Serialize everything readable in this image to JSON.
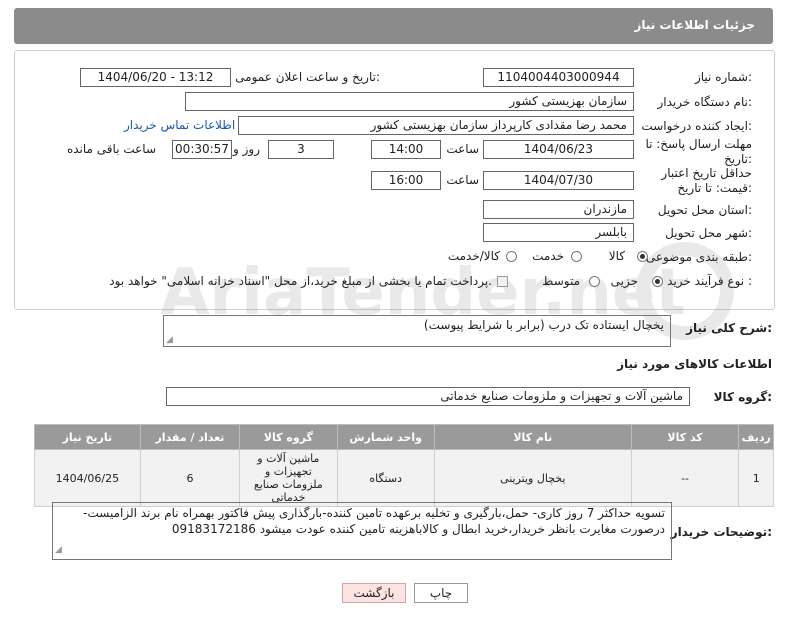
{
  "header": {
    "title": "جزئیات اطلاعات نیاز"
  },
  "fields": {
    "need_number_label": "شماره نیاز:",
    "need_number": "1104004403000944",
    "announce_label": "تاریخ و ساعت اعلان عمومی:",
    "announce_value": "1404/06/20 - 13:12",
    "buyer_org_label": "نام دستگاه خریدار:",
    "buyer_org": "سازمان بهزیستی کشور",
    "creator_label": "ایجاد کننده درخواست:",
    "creator": "محمد رضا  مقدادی کارپرداز سازمان بهزیستی کشور",
    "contact_link": "اطلاعات تماس خریدار",
    "reply_deadline_label": "مهلت ارسال پاسخ: تا تاریخ:",
    "reply_date": "1404/06/23",
    "time_label": "ساعت",
    "reply_time": "14:00",
    "days_value": "3",
    "days_label": "روز و",
    "remaining_time": "00:30:57",
    "remaining_label": "ساعت باقی مانده",
    "price_deadline_label": "حداقل تاریخ اعتبار قیمت: تا تاریخ:",
    "price_date": "1404/07/30",
    "price_time": "16:00",
    "province_label": "استان محل تحویل:",
    "province": "مازندران",
    "city_label": "شهر محل تحویل:",
    "city": "بابلسر",
    "category_label": "طبقه بندی موضوعی:",
    "category_options": [
      "کالا",
      "خدمت",
      "کالا/خدمت"
    ],
    "process_label": "نوع فرآیند خرید :",
    "process_options": [
      "جزیی",
      "متوسط"
    ],
    "payment_note": "پرداخت تمام یا بخشی از مبلغ خرید،از محل \"اسناد خزانه اسلامی\" خواهد بود."
  },
  "summary": {
    "label": "شرح کلی نیاز:",
    "value": "یخچال ایستاده تک درب (برابر با شرایط پیوست)"
  },
  "goods_info_title": "اطلاعات کالاهای مورد نیاز",
  "goods_group": {
    "label": "گروه کالا:",
    "value": "ماشین آلات و تجهیزات و ملزومات صنایع خدماتی"
  },
  "table": {
    "headers": [
      "ردیف",
      "کد کالا",
      "نام کالا",
      "واحد شمارش",
      "گروه کالا",
      "تعداد / مقدار",
      "تاریخ نیاز"
    ],
    "rows": [
      [
        "1",
        "--",
        "یخچال ویترینی",
        "دستگاه",
        "ماشین آلات و تجهیزات و ملزومات صنایع خدماتی",
        "6",
        "1404/06/25"
      ]
    ]
  },
  "buyer_notes": {
    "label": "توضیحات خریدار:",
    "value": "تسویه حداکثر 7 روز کاری- حمل،بارگیری و تخلیه برعهده تامین کننده-بارگذاری پیش فاکتور بهمراه نام برند الزامیست- درصورت مغایرت بانظر خریدار،خرید ابطال و کالاباهزینه تامین کننده عودت میشود 09183172186"
  },
  "buttons": {
    "print": "چاپ",
    "back": "بازگشت"
  },
  "watermark": {
    "text": "AriaTender.net"
  }
}
